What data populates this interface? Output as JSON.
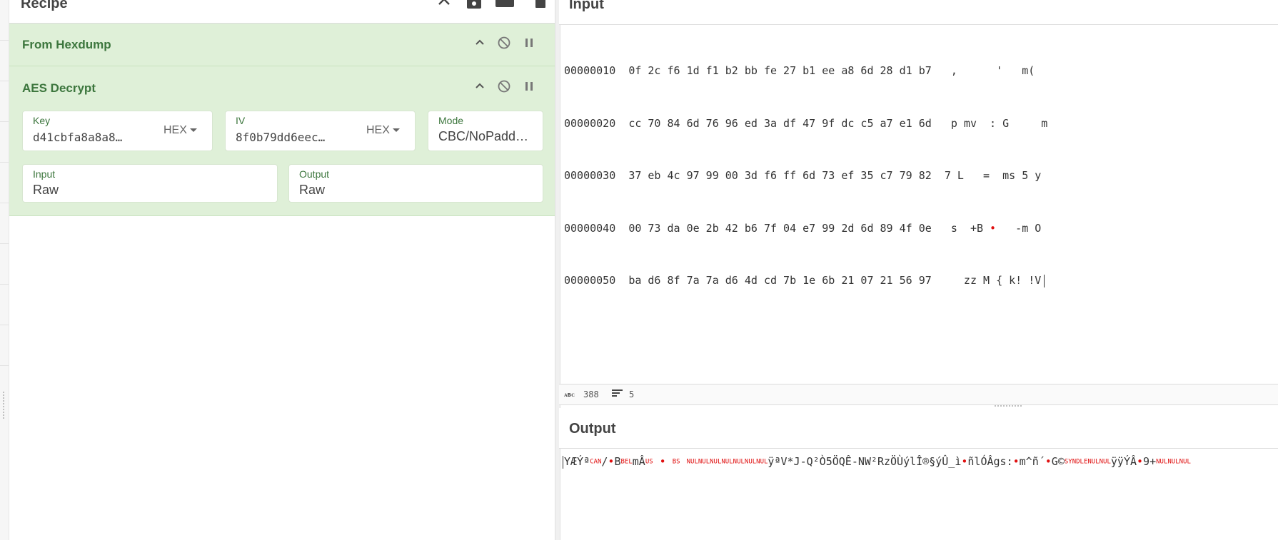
{
  "recipe": {
    "title": "Recipe",
    "header_icons": [
      "chevron-up-icon",
      "save-icon",
      "folder-icon",
      "trash-icon"
    ],
    "operations": [
      {
        "name": "From Hexdump"
      },
      {
        "name": "AES Decrypt",
        "key": {
          "label": "Key",
          "value": "d41cbfa8a8a8…",
          "format": "HEX"
        },
        "iv": {
          "label": "IV",
          "value": "8f0b79dd6eec…",
          "format": "HEX"
        },
        "mode": {
          "label": "Mode",
          "value": "CBC/NoPadd…"
        },
        "input": {
          "label": "Input",
          "value": "Raw"
        },
        "output": {
          "label": "Output",
          "value": "Raw"
        }
      }
    ]
  },
  "input_panel": {
    "title": "Input",
    "lines": [
      {
        "offset": "00000010",
        "hex": "0f 2c f6 1d f1 b2 bb fe 27 b1 ee a8 6d 28 d1 b7",
        "ascii": " ,      '   m("
      },
      {
        "offset": "00000020",
        "hex": "cc 70 84 6d 76 96 ed 3a df 47 9f dc c5 a7 e1 6d",
        "ascii": " p mv  : G     m"
      },
      {
        "offset": "00000030",
        "hex": "37 eb 4c 97 99 00 3d f6 ff 6d 73 ef 35 c7 79 82",
        "ascii": "7 L   =  ms 5 y"
      },
      {
        "offset": "00000040",
        "hex": "00 73 da 0e 2b 42 b6 7f 04 e7 99 2d 6d 89 4f 0e",
        "ascii_a": " s  +B ",
        "ascii_b": "   -m O"
      },
      {
        "offset": "00000050",
        "hex": "ba d6 8f 7a 7a d6 4d cd 7b 1e 6b 21 07 21 56 97",
        "ascii": "   zz M { k! !V"
      }
    ],
    "status": {
      "chars": "388",
      "lines": "5"
    }
  },
  "output_panel": {
    "title": "Output",
    "segments": [
      {
        "t": "YÆÝª",
        "k": "n"
      },
      {
        "t": "CAN",
        "k": "c"
      },
      {
        "t": "/",
        "k": "n"
      },
      {
        "t": "•",
        "k": "r"
      },
      {
        "t": "B",
        "k": "n"
      },
      {
        "t": "BEL",
        "k": "c"
      },
      {
        "t": "mÂ",
        "k": "n"
      },
      {
        "t": "US",
        "k": "c"
      },
      {
        "t": " • ",
        "k": "r"
      },
      {
        "t": "BS",
        "k": "c"
      },
      {
        "t": " ",
        "k": "n"
      },
      {
        "t": "NULNULNULNULNULNULNUL",
        "k": "c"
      },
      {
        "t": "ÿªV*J-Q²Ò5ÖQÊ-NW²RzÖÙýlÎ®§ýÛ_ì",
        "k": "n"
      },
      {
        "t": "•",
        "k": "r"
      },
      {
        "t": "ñlÓÂgs:",
        "k": "n"
      },
      {
        "t": "•",
        "k": "r"
      },
      {
        "t": "m^ñ´",
        "k": "n"
      },
      {
        "t": "•",
        "k": "r"
      },
      {
        "t": "G©",
        "k": "n"
      },
      {
        "t": "SYNDLENULNUL",
        "k": "c"
      },
      {
        "t": "ÿÿÝÂ",
        "k": "n"
      },
      {
        "t": "•",
        "k": "r"
      },
      {
        "t": "9+",
        "k": "n"
      },
      {
        "t": "NULNULNUL",
        "k": "c"
      }
    ]
  }
}
